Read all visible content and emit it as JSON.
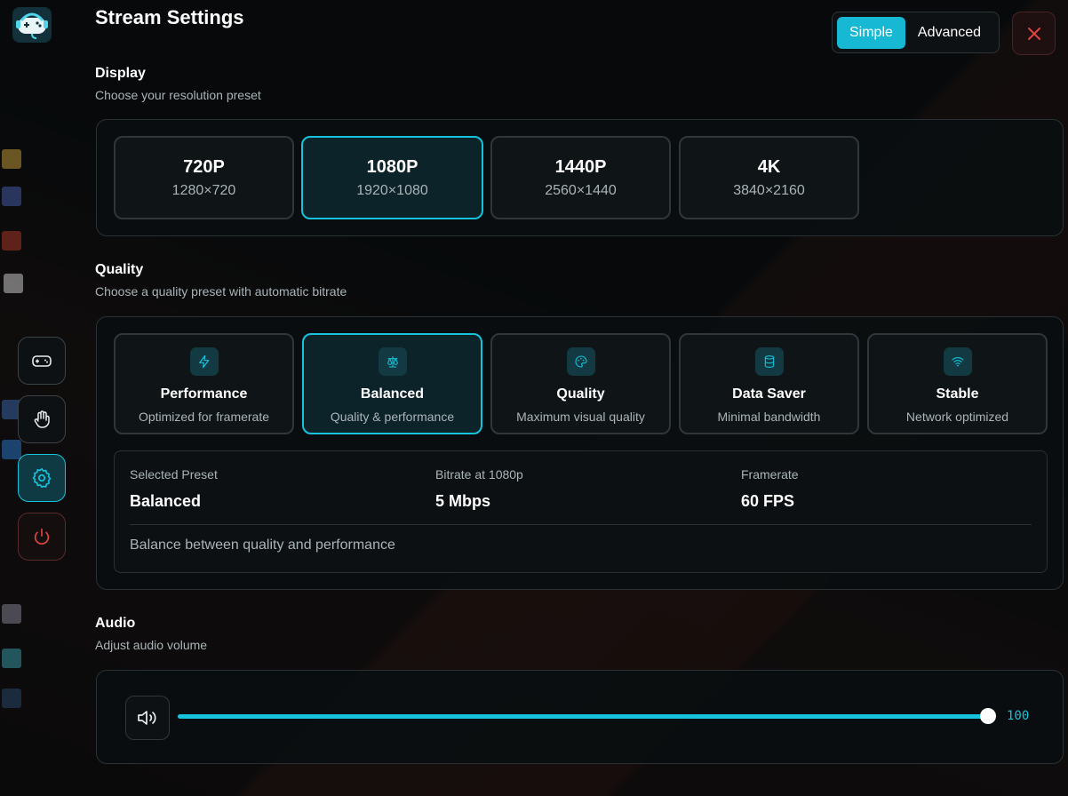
{
  "header": {
    "title": "Stream Settings",
    "mode_options": [
      {
        "label": "Simple",
        "selected": true
      },
      {
        "label": "Advanced",
        "selected": false
      }
    ]
  },
  "sidebar": {
    "items": [
      {
        "name": "gamepad",
        "icon": "gamepad-icon",
        "active": false
      },
      {
        "name": "hand",
        "icon": "hand-icon",
        "active": false
      },
      {
        "name": "settings",
        "icon": "gear-icon",
        "active": true
      },
      {
        "name": "power",
        "icon": "power-icon",
        "active": false
      }
    ]
  },
  "display": {
    "title": "Display",
    "subtitle": "Choose your resolution preset",
    "presets": [
      {
        "name": "720P",
        "resolution": "1280×720",
        "selected": false
      },
      {
        "name": "1080P",
        "resolution": "1920×1080",
        "selected": true
      },
      {
        "name": "1440P",
        "resolution": "2560×1440",
        "selected": false
      },
      {
        "name": "4K",
        "resolution": "3840×2160",
        "selected": false
      }
    ]
  },
  "quality": {
    "title": "Quality",
    "subtitle": "Choose a quality preset with automatic bitrate",
    "presets": [
      {
        "name": "Performance",
        "description": "Optimized for framerate",
        "icon": "lightning-icon",
        "selected": false
      },
      {
        "name": "Balanced",
        "description": "Quality & performance",
        "icon": "scale-icon",
        "selected": true
      },
      {
        "name": "Quality",
        "description": "Maximum visual quality",
        "icon": "palette-icon",
        "selected": false
      },
      {
        "name": "Data Saver",
        "description": "Minimal bandwidth",
        "icon": "database-icon",
        "selected": false
      },
      {
        "name": "Stable",
        "description": "Network optimized",
        "icon": "wifi-icon",
        "selected": false
      }
    ],
    "summary": {
      "selected_label": "Selected Preset",
      "selected_value": "Balanced",
      "bitrate_label": "Bitrate at 1080p",
      "bitrate_value": "5 Mbps",
      "framerate_label": "Framerate",
      "framerate_value": "60 FPS",
      "description": "Balance between quality and performance"
    }
  },
  "audio": {
    "title": "Audio",
    "subtitle": "Adjust audio volume",
    "volume": 100,
    "volume_label": "100",
    "volume_max": 100
  },
  "colors": {
    "accent": "#17c2dc",
    "close": "#e0453f",
    "power": "#e0453f"
  }
}
